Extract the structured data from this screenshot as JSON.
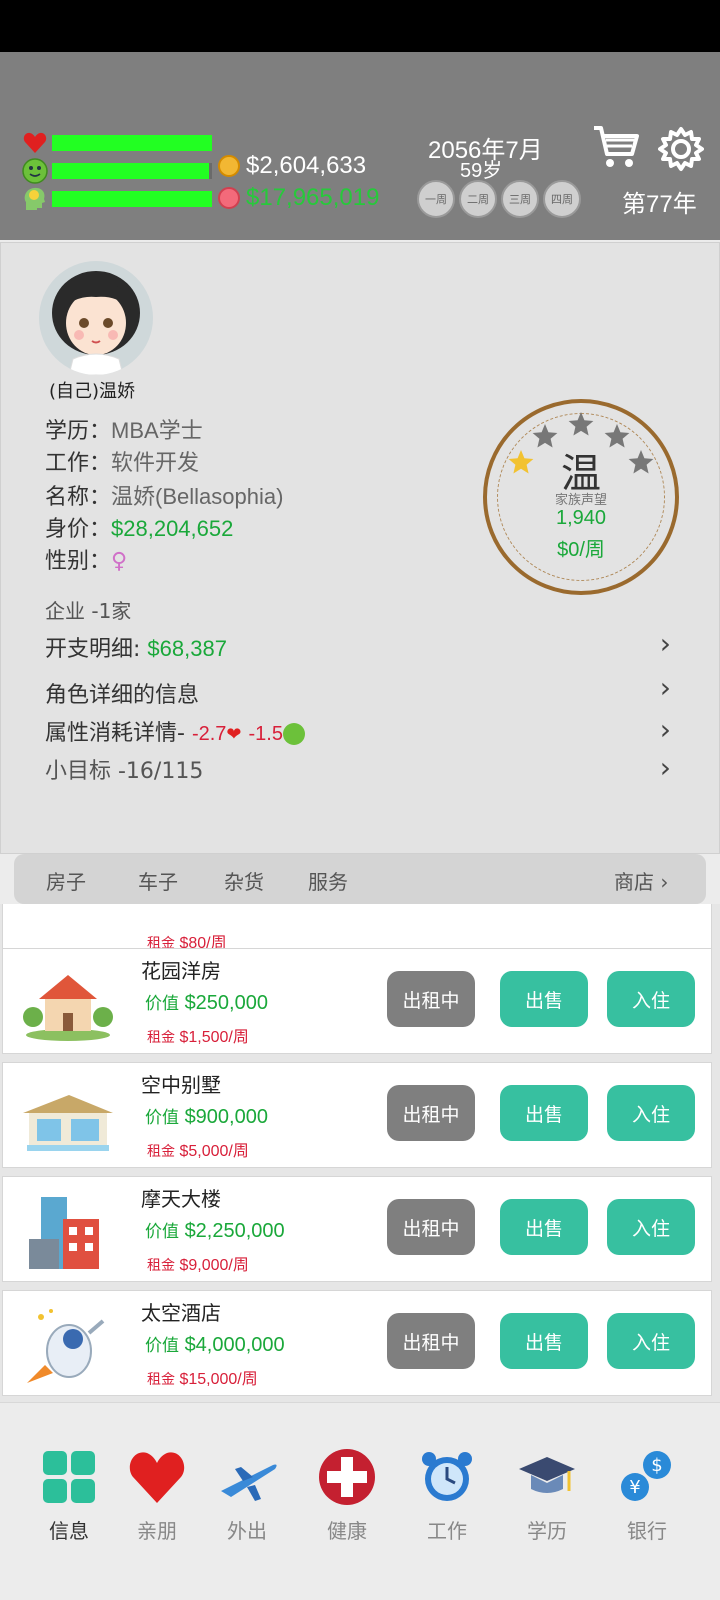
{
  "header": {
    "health_level": 1.0,
    "happiness_level": 0.98,
    "smart_level": 1.0,
    "cash": "$2,604,633",
    "assets": "$17,965,019",
    "date": "2056年7月",
    "age": "59岁",
    "weeks": [
      "一周",
      "二周",
      "三周",
      "四周"
    ],
    "year": "第77年"
  },
  "profile": {
    "avatar_label": "(自己)温娇",
    "education_label": "学历：",
    "education_value": "MBA学士",
    "job_label": "工作：",
    "job_value": "软件开发",
    "name_label": "名称：",
    "name_value": "温娇(Bellasophia)",
    "worth_label": "身价：",
    "worth_value": "$28,204,652",
    "gender_label": "性别：",
    "gender_symbol": "♀"
  },
  "badge": {
    "char": "温",
    "subtitle": "家族声望",
    "reputation": "1,940",
    "rate": "$0/周",
    "stars_total": 5,
    "stars_filled": 1
  },
  "rows": {
    "company": "企业 -1家",
    "expense_label": "开支明细:",
    "expense_value": "$68,387",
    "details": "角色详细的信息",
    "consume_label": "属性消耗详情-",
    "consume_health": "-2.7",
    "consume_happy": "-1.5",
    "goal": "小目标 -16/115"
  },
  "tabs": [
    "房子",
    "车子",
    "杂货",
    "服务",
    "商店"
  ],
  "partial_card": {
    "rent_label": "租金",
    "rent_value": "$80/周"
  },
  "properties": [
    {
      "name": "花园洋房",
      "value_label": "价值",
      "value": "$250,000",
      "rent_label": "租金",
      "rent": "$1,500/周",
      "btn1": "出租中",
      "btn2": "出售",
      "btn3": "入住"
    },
    {
      "name": "空中别墅",
      "value_label": "价值",
      "value": "$900,000",
      "rent_label": "租金",
      "rent": "$5,000/周",
      "btn1": "出租中",
      "btn2": "出售",
      "btn3": "入住"
    },
    {
      "name": "摩天大楼",
      "value_label": "价值",
      "value": "$2,250,000",
      "rent_label": "租金",
      "rent": "$9,000/周",
      "btn1": "出租中",
      "btn2": "出售",
      "btn3": "入住"
    },
    {
      "name": "太空酒店",
      "value_label": "价值",
      "value": "$4,000,000",
      "rent_label": "租金",
      "rent": "$15,000/周",
      "btn1": "出租中",
      "btn2": "出售",
      "btn3": "入住"
    }
  ],
  "nav": [
    "信息",
    "亲朋",
    "外出",
    "健康",
    "工作",
    "学历",
    "银行"
  ],
  "colors": {
    "accent": "#37c0a0",
    "green": "#1aa83a",
    "red": "#d8203a",
    "topbar": "#7f7f7f"
  }
}
